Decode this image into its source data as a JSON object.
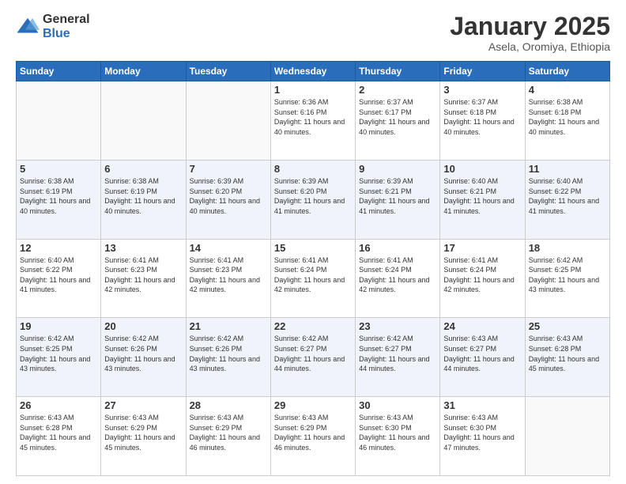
{
  "logo": {
    "general": "General",
    "blue": "Blue"
  },
  "title": "January 2025",
  "subtitle": "Asela, Oromiya, Ethiopia",
  "days_header": [
    "Sunday",
    "Monday",
    "Tuesday",
    "Wednesday",
    "Thursday",
    "Friday",
    "Saturday"
  ],
  "weeks": [
    [
      {
        "day": "",
        "info": ""
      },
      {
        "day": "",
        "info": ""
      },
      {
        "day": "",
        "info": ""
      },
      {
        "day": "1",
        "info": "Sunrise: 6:36 AM\nSunset: 6:16 PM\nDaylight: 11 hours and 40 minutes."
      },
      {
        "day": "2",
        "info": "Sunrise: 6:37 AM\nSunset: 6:17 PM\nDaylight: 11 hours and 40 minutes."
      },
      {
        "day": "3",
        "info": "Sunrise: 6:37 AM\nSunset: 6:18 PM\nDaylight: 11 hours and 40 minutes."
      },
      {
        "day": "4",
        "info": "Sunrise: 6:38 AM\nSunset: 6:18 PM\nDaylight: 11 hours and 40 minutes."
      }
    ],
    [
      {
        "day": "5",
        "info": "Sunrise: 6:38 AM\nSunset: 6:19 PM\nDaylight: 11 hours and 40 minutes."
      },
      {
        "day": "6",
        "info": "Sunrise: 6:38 AM\nSunset: 6:19 PM\nDaylight: 11 hours and 40 minutes."
      },
      {
        "day": "7",
        "info": "Sunrise: 6:39 AM\nSunset: 6:20 PM\nDaylight: 11 hours and 40 minutes."
      },
      {
        "day": "8",
        "info": "Sunrise: 6:39 AM\nSunset: 6:20 PM\nDaylight: 11 hours and 41 minutes."
      },
      {
        "day": "9",
        "info": "Sunrise: 6:39 AM\nSunset: 6:21 PM\nDaylight: 11 hours and 41 minutes."
      },
      {
        "day": "10",
        "info": "Sunrise: 6:40 AM\nSunset: 6:21 PM\nDaylight: 11 hours and 41 minutes."
      },
      {
        "day": "11",
        "info": "Sunrise: 6:40 AM\nSunset: 6:22 PM\nDaylight: 11 hours and 41 minutes."
      }
    ],
    [
      {
        "day": "12",
        "info": "Sunrise: 6:40 AM\nSunset: 6:22 PM\nDaylight: 11 hours and 41 minutes."
      },
      {
        "day": "13",
        "info": "Sunrise: 6:41 AM\nSunset: 6:23 PM\nDaylight: 11 hours and 42 minutes."
      },
      {
        "day": "14",
        "info": "Sunrise: 6:41 AM\nSunset: 6:23 PM\nDaylight: 11 hours and 42 minutes."
      },
      {
        "day": "15",
        "info": "Sunrise: 6:41 AM\nSunset: 6:24 PM\nDaylight: 11 hours and 42 minutes."
      },
      {
        "day": "16",
        "info": "Sunrise: 6:41 AM\nSunset: 6:24 PM\nDaylight: 11 hours and 42 minutes."
      },
      {
        "day": "17",
        "info": "Sunrise: 6:41 AM\nSunset: 6:24 PM\nDaylight: 11 hours and 42 minutes."
      },
      {
        "day": "18",
        "info": "Sunrise: 6:42 AM\nSunset: 6:25 PM\nDaylight: 11 hours and 43 minutes."
      }
    ],
    [
      {
        "day": "19",
        "info": "Sunrise: 6:42 AM\nSunset: 6:25 PM\nDaylight: 11 hours and 43 minutes."
      },
      {
        "day": "20",
        "info": "Sunrise: 6:42 AM\nSunset: 6:26 PM\nDaylight: 11 hours and 43 minutes."
      },
      {
        "day": "21",
        "info": "Sunrise: 6:42 AM\nSunset: 6:26 PM\nDaylight: 11 hours and 43 minutes."
      },
      {
        "day": "22",
        "info": "Sunrise: 6:42 AM\nSunset: 6:27 PM\nDaylight: 11 hours and 44 minutes."
      },
      {
        "day": "23",
        "info": "Sunrise: 6:42 AM\nSunset: 6:27 PM\nDaylight: 11 hours and 44 minutes."
      },
      {
        "day": "24",
        "info": "Sunrise: 6:43 AM\nSunset: 6:27 PM\nDaylight: 11 hours and 44 minutes."
      },
      {
        "day": "25",
        "info": "Sunrise: 6:43 AM\nSunset: 6:28 PM\nDaylight: 11 hours and 45 minutes."
      }
    ],
    [
      {
        "day": "26",
        "info": "Sunrise: 6:43 AM\nSunset: 6:28 PM\nDaylight: 11 hours and 45 minutes."
      },
      {
        "day": "27",
        "info": "Sunrise: 6:43 AM\nSunset: 6:29 PM\nDaylight: 11 hours and 45 minutes."
      },
      {
        "day": "28",
        "info": "Sunrise: 6:43 AM\nSunset: 6:29 PM\nDaylight: 11 hours and 46 minutes."
      },
      {
        "day": "29",
        "info": "Sunrise: 6:43 AM\nSunset: 6:29 PM\nDaylight: 11 hours and 46 minutes."
      },
      {
        "day": "30",
        "info": "Sunrise: 6:43 AM\nSunset: 6:30 PM\nDaylight: 11 hours and 46 minutes."
      },
      {
        "day": "31",
        "info": "Sunrise: 6:43 AM\nSunset: 6:30 PM\nDaylight: 11 hours and 47 minutes."
      },
      {
        "day": "",
        "info": ""
      }
    ]
  ]
}
